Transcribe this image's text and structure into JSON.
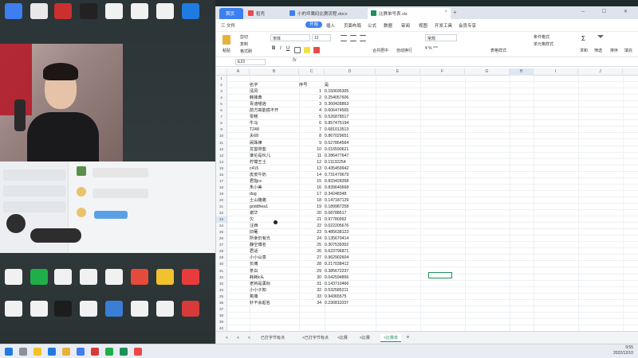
{
  "browser": {
    "tabs": [
      {
        "label": "首页",
        "color": "#3d7ff0"
      },
      {
        "label": "稻壳",
        "color": "#e84a4a"
      },
      {
        "label": "小的坪鹰码比赛流程.docx",
        "color": "#3d7ff0"
      },
      {
        "label": "比赛单号表.xls",
        "color": "#1e8f5a"
      }
    ],
    "new_tab": "+",
    "window_controls": "─ ☐ ✕"
  },
  "menu": {
    "file": "三 文件",
    "items": [
      "开始",
      "插入",
      "页面布局",
      "公式",
      "数据",
      "审阅",
      "视图",
      "开发工具",
      "会员专享"
    ],
    "selected": "开始"
  },
  "ribbon": {
    "paste": "粘贴",
    "cut": "剪切",
    "copy": "复制",
    "format_painter": "格式刷",
    "font": "宋体",
    "font_size": "12",
    "merge": "合并居中",
    "wrap": "自动换行",
    "number_format": "常规",
    "conditional": "条件格式",
    "cell_style": "表格样式",
    "sum": "求和",
    "filter": "筛选",
    "sort": "排序",
    "fill": "填充",
    "row_col": "行和列",
    "worksheet": "工作表",
    "freeze": "冻结窗格",
    "insert_row": "单元格样式"
  },
  "formula": {
    "name_box": "E23",
    "fx": "fx"
  },
  "grid": {
    "columns": [
      "A",
      "B",
      "C",
      "D",
      "E",
      "F",
      "G",
      "H",
      "I",
      "J",
      "K"
    ],
    "selected_column": "H",
    "selected_row": 23,
    "header_row": {
      "row": 2,
      "b": "名字",
      "c": "序号",
      "d": "是"
    },
    "rows": [
      {
        "b": "清风",
        "c": "1",
        "d": "0.150695305"
      },
      {
        "b": "韩锋典",
        "c": "2",
        "d": "0.254057606"
      },
      {
        "b": "青迪喵逍",
        "c": "3",
        "d": "0.360428863"
      },
      {
        "b": "前方高能癌不开",
        "c": "4",
        "d": "0.606474565"
      },
      {
        "b": "零糕",
        "c": "5",
        "d": "0.526878517"
      },
      {
        "b": "牛马",
        "c": "6",
        "d": "0.857475194"
      },
      {
        "b": "T248",
        "c": "7",
        "d": "0.681013513"
      },
      {
        "b": "夫68",
        "c": "8",
        "d": "0.867029651"
      },
      {
        "b": "闹珠律",
        "c": "9",
        "d": "0.527864564"
      },
      {
        "b": "龙首苛盐",
        "c": "10",
        "d": "0.016590621"
      },
      {
        "b": "谁伦是伙儿",
        "c": "11",
        "d": "0.286477647"
      },
      {
        "b": "柠檬王士",
        "c": "12",
        "d": "0.11132254"
      },
      {
        "b": "c415",
        "c": "13",
        "d": "0.435459942"
      },
      {
        "b": "皮皮牛奶",
        "c": "14",
        "d": "0.731479679"
      },
      {
        "b": "君指cc",
        "c": "15",
        "d": "0.833428358"
      },
      {
        "b": "朱小美",
        "c": "16",
        "d": "0.839640668"
      },
      {
        "b": "dog",
        "c": "17",
        "d": "0.34248348"
      },
      {
        "b": "土山貉貉",
        "c": "18",
        "d": "0.147187129"
      },
      {
        "b": "goddhea1",
        "c": "19",
        "d": "0.189987258"
      },
      {
        "b": "谢华",
        "c": "20",
        "d": "0.08788517"
      },
      {
        "b": "欠",
        "c": "21",
        "d": "0.97780992"
      },
      {
        "b": "汪西",
        "c": "22",
        "d": "0.022205676"
      },
      {
        "b": "旧葡",
        "c": "23",
        "d": "0.485638123"
      },
      {
        "b": "所幸仍有光",
        "c": "24",
        "d": "0.135670414"
      },
      {
        "b": "静空博名",
        "c": "25",
        "d": "0.307539302"
      },
      {
        "b": "君话",
        "c": "26",
        "d": "0.623796871"
      },
      {
        "b": "小小山意",
        "c": "27",
        "d": "0.962902604"
      },
      {
        "b": "长痛",
        "c": "28",
        "d": "0.217038412"
      },
      {
        "b": "茶白",
        "c": "29",
        "d": "0.385672237"
      },
      {
        "b": "耗耗k头",
        "c": "30",
        "d": "0.042594856"
      },
      {
        "b": "老钩是黑标",
        "c": "31",
        "d": "0.143710466"
      },
      {
        "b": "小小子知",
        "c": "32",
        "d": "0.532585211"
      },
      {
        "b": "氧痛",
        "c": "33",
        "d": "0.94365575"
      },
      {
        "b": "针不会起名",
        "c": "34",
        "d": "0.230811037"
      }
    ],
    "row_numbers_empty": [
      37,
      38,
      39,
      40
    ]
  },
  "sheets": {
    "tabs": [
      "<",
      "<",
      "<",
      "已打字节有点",
      "<已打字节有点",
      "<比赛",
      "<比赛",
      "<比赛单"
    ],
    "active": "<比赛单",
    "add": "+"
  },
  "clock": {
    "time": "9:55",
    "date": "2022/12/10"
  },
  "colors": {
    "accent": "#3d7ff0",
    "sheet_green": "#1e8f5a",
    "taskbar": "#e9edf3"
  }
}
